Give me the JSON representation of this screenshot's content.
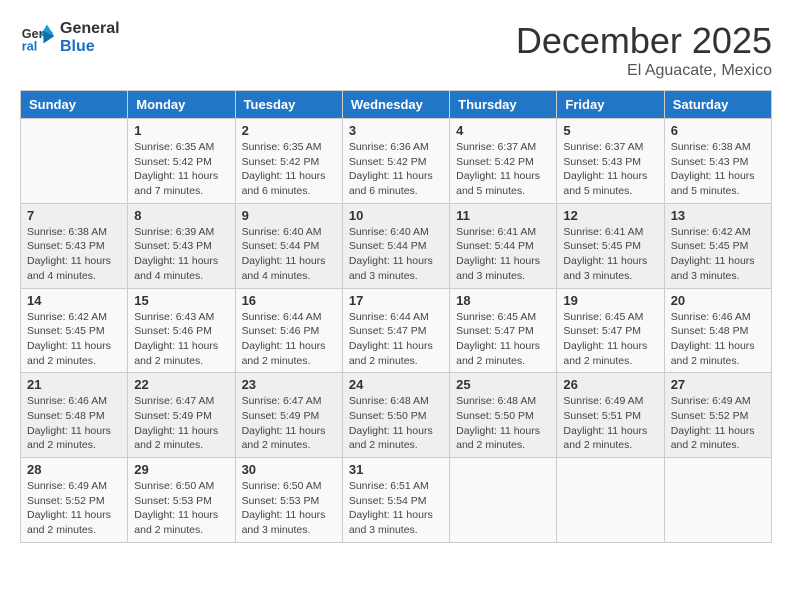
{
  "header": {
    "logo_line1": "General",
    "logo_line2": "Blue",
    "month": "December 2025",
    "location": "El Aguacate, Mexico"
  },
  "days_of_week": [
    "Sunday",
    "Monday",
    "Tuesday",
    "Wednesday",
    "Thursday",
    "Friday",
    "Saturday"
  ],
  "weeks": [
    [
      {
        "day": "",
        "info": ""
      },
      {
        "day": "1",
        "info": "Sunrise: 6:35 AM\nSunset: 5:42 PM\nDaylight: 11 hours\nand 7 minutes."
      },
      {
        "day": "2",
        "info": "Sunrise: 6:35 AM\nSunset: 5:42 PM\nDaylight: 11 hours\nand 6 minutes."
      },
      {
        "day": "3",
        "info": "Sunrise: 6:36 AM\nSunset: 5:42 PM\nDaylight: 11 hours\nand 6 minutes."
      },
      {
        "day": "4",
        "info": "Sunrise: 6:37 AM\nSunset: 5:42 PM\nDaylight: 11 hours\nand 5 minutes."
      },
      {
        "day": "5",
        "info": "Sunrise: 6:37 AM\nSunset: 5:43 PM\nDaylight: 11 hours\nand 5 minutes."
      },
      {
        "day": "6",
        "info": "Sunrise: 6:38 AM\nSunset: 5:43 PM\nDaylight: 11 hours\nand 5 minutes."
      }
    ],
    [
      {
        "day": "7",
        "info": "Sunrise: 6:38 AM\nSunset: 5:43 PM\nDaylight: 11 hours\nand 4 minutes."
      },
      {
        "day": "8",
        "info": "Sunrise: 6:39 AM\nSunset: 5:43 PM\nDaylight: 11 hours\nand 4 minutes."
      },
      {
        "day": "9",
        "info": "Sunrise: 6:40 AM\nSunset: 5:44 PM\nDaylight: 11 hours\nand 4 minutes."
      },
      {
        "day": "10",
        "info": "Sunrise: 6:40 AM\nSunset: 5:44 PM\nDaylight: 11 hours\nand 3 minutes."
      },
      {
        "day": "11",
        "info": "Sunrise: 6:41 AM\nSunset: 5:44 PM\nDaylight: 11 hours\nand 3 minutes."
      },
      {
        "day": "12",
        "info": "Sunrise: 6:41 AM\nSunset: 5:45 PM\nDaylight: 11 hours\nand 3 minutes."
      },
      {
        "day": "13",
        "info": "Sunrise: 6:42 AM\nSunset: 5:45 PM\nDaylight: 11 hours\nand 3 minutes."
      }
    ],
    [
      {
        "day": "14",
        "info": "Sunrise: 6:42 AM\nSunset: 5:45 PM\nDaylight: 11 hours\nand 2 minutes."
      },
      {
        "day": "15",
        "info": "Sunrise: 6:43 AM\nSunset: 5:46 PM\nDaylight: 11 hours\nand 2 minutes."
      },
      {
        "day": "16",
        "info": "Sunrise: 6:44 AM\nSunset: 5:46 PM\nDaylight: 11 hours\nand 2 minutes."
      },
      {
        "day": "17",
        "info": "Sunrise: 6:44 AM\nSunset: 5:47 PM\nDaylight: 11 hours\nand 2 minutes."
      },
      {
        "day": "18",
        "info": "Sunrise: 6:45 AM\nSunset: 5:47 PM\nDaylight: 11 hours\nand 2 minutes."
      },
      {
        "day": "19",
        "info": "Sunrise: 6:45 AM\nSunset: 5:47 PM\nDaylight: 11 hours\nand 2 minutes."
      },
      {
        "day": "20",
        "info": "Sunrise: 6:46 AM\nSunset: 5:48 PM\nDaylight: 11 hours\nand 2 minutes."
      }
    ],
    [
      {
        "day": "21",
        "info": "Sunrise: 6:46 AM\nSunset: 5:48 PM\nDaylight: 11 hours\nand 2 minutes."
      },
      {
        "day": "22",
        "info": "Sunrise: 6:47 AM\nSunset: 5:49 PM\nDaylight: 11 hours\nand 2 minutes."
      },
      {
        "day": "23",
        "info": "Sunrise: 6:47 AM\nSunset: 5:49 PM\nDaylight: 11 hours\nand 2 minutes."
      },
      {
        "day": "24",
        "info": "Sunrise: 6:48 AM\nSunset: 5:50 PM\nDaylight: 11 hours\nand 2 minutes."
      },
      {
        "day": "25",
        "info": "Sunrise: 6:48 AM\nSunset: 5:50 PM\nDaylight: 11 hours\nand 2 minutes."
      },
      {
        "day": "26",
        "info": "Sunrise: 6:49 AM\nSunset: 5:51 PM\nDaylight: 11 hours\nand 2 minutes."
      },
      {
        "day": "27",
        "info": "Sunrise: 6:49 AM\nSunset: 5:52 PM\nDaylight: 11 hours\nand 2 minutes."
      }
    ],
    [
      {
        "day": "28",
        "info": "Sunrise: 6:49 AM\nSunset: 5:52 PM\nDaylight: 11 hours\nand 2 minutes."
      },
      {
        "day": "29",
        "info": "Sunrise: 6:50 AM\nSunset: 5:53 PM\nDaylight: 11 hours\nand 2 minutes."
      },
      {
        "day": "30",
        "info": "Sunrise: 6:50 AM\nSunset: 5:53 PM\nDaylight: 11 hours\nand 3 minutes."
      },
      {
        "day": "31",
        "info": "Sunrise: 6:51 AM\nSunset: 5:54 PM\nDaylight: 11 hours\nand 3 minutes."
      },
      {
        "day": "",
        "info": ""
      },
      {
        "day": "",
        "info": ""
      },
      {
        "day": "",
        "info": ""
      }
    ]
  ]
}
